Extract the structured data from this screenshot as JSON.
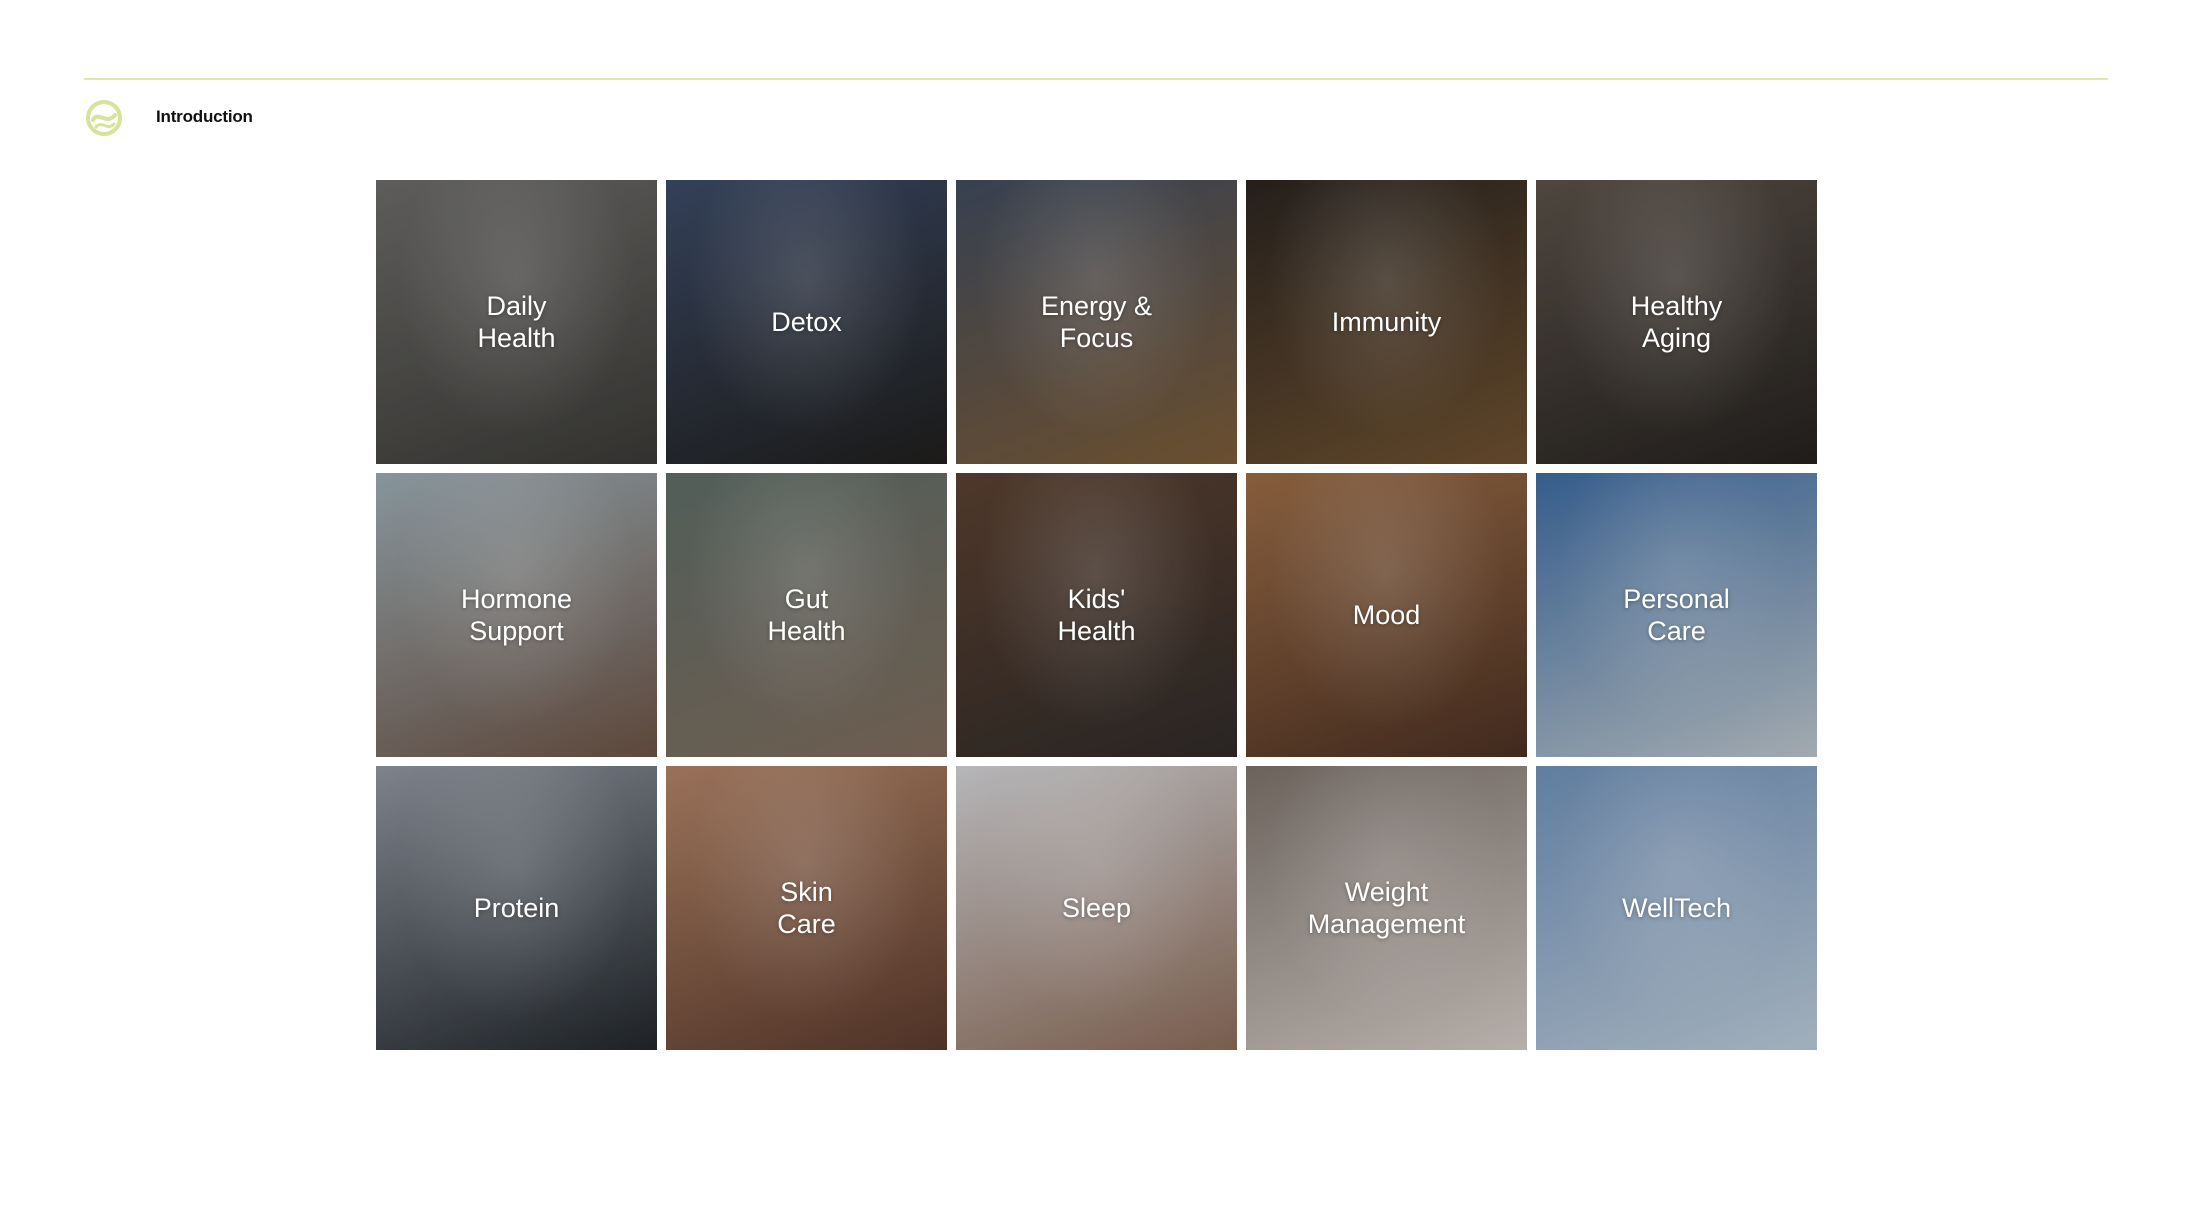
{
  "header": {
    "section_title": "Introduction",
    "accent_color": "#d7e29a",
    "logo_icon": "swirl-logo-icon"
  },
  "tiles": [
    {
      "label": "Daily\nHealth",
      "bg": [
        "#6b6a68",
        "#3a3936"
      ]
    },
    {
      "label": "Detox",
      "bg": [
        "#3b4a66",
        "#1f1e1c"
      ]
    },
    {
      "label": "Energy &\nFocus",
      "bg": [
        "#3f4a5c",
        "#7a5a36"
      ]
    },
    {
      "label": "Immunity",
      "bg": [
        "#2a2420",
        "#6d5030"
      ]
    },
    {
      "label": "Healthy\nAging",
      "bg": [
        "#5a5148",
        "#24211f"
      ]
    },
    {
      "label": "Hormone\nSupport",
      "bg": [
        "#9aaab2",
        "#6a5244"
      ]
    },
    {
      "label": "Gut\nHealth",
      "bg": [
        "#5d6c66",
        "#7d6a5c"
      ]
    },
    {
      "label": "Kids'\nHealth",
      "bg": [
        "#5a4030",
        "#2f2a28"
      ]
    },
    {
      "label": "Mood",
      "bg": [
        "#9a6b46",
        "#4a3022"
      ]
    },
    {
      "label": "Personal\nCare",
      "bg": [
        "#3d6aa0",
        "#b9c2c8"
      ]
    },
    {
      "label": "Protein",
      "bg": [
        "#8f96a0",
        "#22262a"
      ]
    },
    {
      "label": "Skin\nCare",
      "bg": [
        "#b08266",
        "#5a3a2c"
      ]
    },
    {
      "label": "Sleep",
      "bg": [
        "#cfcfd2",
        "#8a6a58"
      ]
    },
    {
      "label": "Weight\nManagement",
      "bg": [
        "#7c716a",
        "#cfc8c2"
      ]
    },
    {
      "label": "WellTech",
      "bg": [
        "#6f8fb6",
        "#b8c8d6"
      ]
    }
  ]
}
